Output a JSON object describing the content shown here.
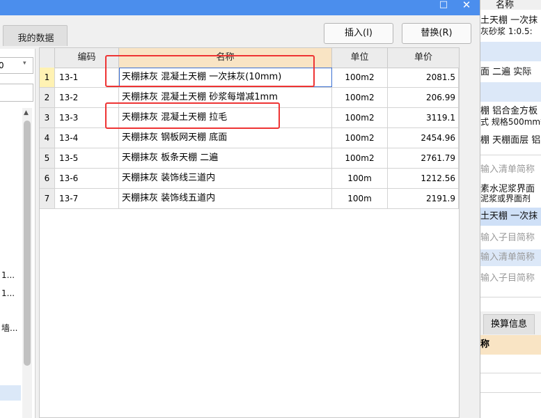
{
  "window": {
    "max_glyph": "□",
    "close_glyph": "✕"
  },
  "tabs": {
    "my_data": "我的数据"
  },
  "toolbar": {
    "insert_label": "插入(I)",
    "replace_label": "替换(R)"
  },
  "left_panel": {
    "combo_value": "0",
    "combo_arrow": "▾",
    "scroll_up": "▲",
    "items": [
      "1...",
      "1...",
      "墙..."
    ]
  },
  "grid": {
    "headers": {
      "code": "编码",
      "name": "名称",
      "unit": "单位",
      "price": "单价"
    },
    "rows": [
      {
        "index": "1",
        "code": "13-1",
        "name": "天棚抹灰 混凝土天棚 一次抹灰(10mm)",
        "unit": "100m2",
        "price": "2081.5"
      },
      {
        "index": "2",
        "code": "13-2",
        "name": "天棚抹灰 混凝土天棚 砂浆每增减1mm",
        "unit": "100m2",
        "price": "206.99"
      },
      {
        "index": "3",
        "code": "13-3",
        "name": "天棚抹灰 混凝土天棚 拉毛",
        "unit": "100m2",
        "price": "3119.1"
      },
      {
        "index": "4",
        "code": "13-4",
        "name": "天棚抹灰 钢板网天棚 底面",
        "unit": "100m2",
        "price": "2454.96"
      },
      {
        "index": "5",
        "code": "13-5",
        "name": "天棚抹灰 板条天棚 二遍",
        "unit": "100m2",
        "price": "2761.79"
      },
      {
        "index": "6",
        "code": "13-6",
        "name": "天棚抹灰 装饰线三道内",
        "unit": "100m",
        "price": "1212.56"
      },
      {
        "index": "7",
        "code": "13-7",
        "name": "天棚抹灰 装饰线五道内",
        "unit": "100m",
        "price": "2191.9"
      }
    ]
  },
  "right_panel": {
    "col_header": "名称",
    "lines": [
      "土天棚 一次抹",
      "灰砂浆 1:0.5:",
      "面 二遍 实际",
      "棚 铝合金方板",
      "式 规格500mm*",
      "棚 天棚面层 铝",
      "输入清单简称",
      "素水泥浆界面",
      "泥浆或界面剂",
      "土天棚 一次抹",
      "输入子目简称",
      "输入清单简称",
      "输入子目简称"
    ],
    "tab_label": "换算信息",
    "table_header": "称"
  },
  "colors": {
    "titlebar": "#4b8eed",
    "highlight": "#e33333",
    "name_header": "#f9e4c4"
  }
}
